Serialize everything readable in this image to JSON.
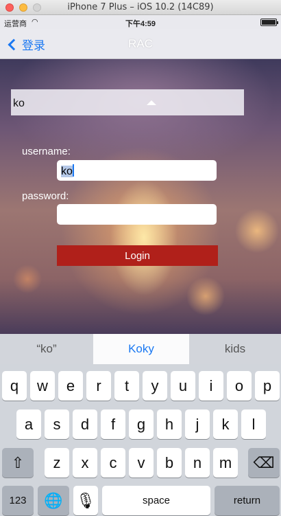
{
  "window": {
    "title": "iPhone 7 Plus – iOS 10.2 (14C89)"
  },
  "status_bar": {
    "carrier": "运营商",
    "time": "下午4:59"
  },
  "nav": {
    "back_label": "登录",
    "title": "RAC"
  },
  "form": {
    "echo_text": "ko",
    "username_label": "username:",
    "username_value": "ko",
    "password_label": "password:",
    "password_value": "",
    "login_label": "Login"
  },
  "suggestions": [
    "“ko”",
    "Koky",
    "kids"
  ],
  "keyboard": {
    "row1": [
      "q",
      "w",
      "e",
      "r",
      "t",
      "y",
      "u",
      "i",
      "o",
      "p"
    ],
    "row2": [
      "a",
      "s",
      "d",
      "f",
      "g",
      "h",
      "j",
      "k",
      "l"
    ],
    "row3": [
      "z",
      "x",
      "c",
      "v",
      "b",
      "n",
      "m"
    ],
    "numbers_label": "123",
    "space_label": "space",
    "return_label": "return"
  },
  "colors": {
    "accent": "#1a78f2",
    "login_button": "#b0201a"
  }
}
